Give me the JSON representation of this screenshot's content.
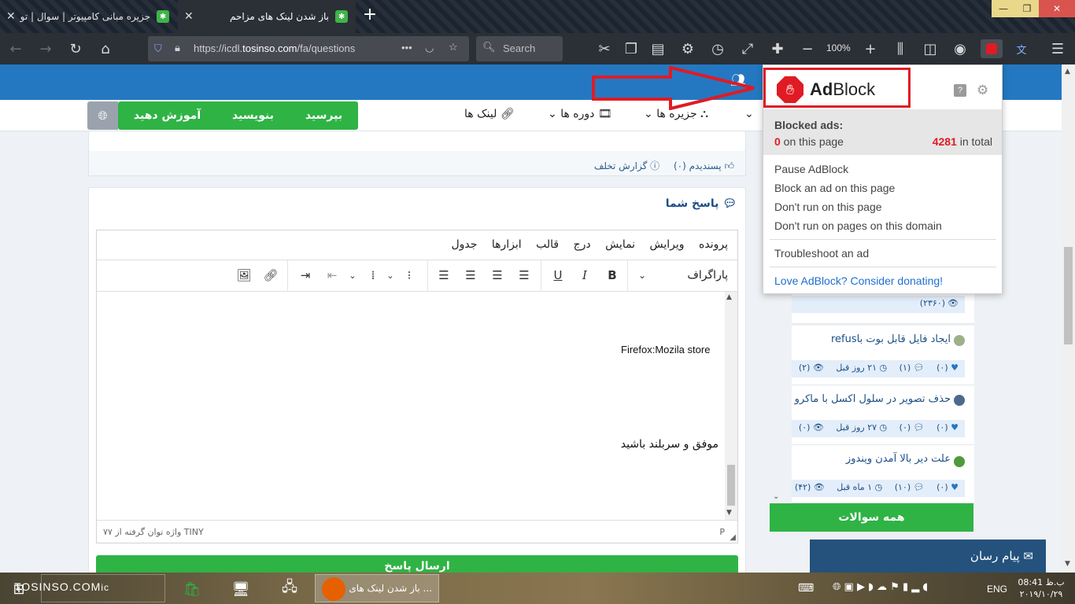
{
  "browser": {
    "tabs": [
      {
        "title": "جزیره مبانی کامپیوتر | سوال | تو",
        "active": false
      },
      {
        "title": "باز شدن لینک های مزاحم",
        "active": true
      }
    ],
    "url_prefix": "https://icdl.",
    "url_host": "tosinso.com",
    "url_path": "/fa/questions",
    "search_placeholder": "Search",
    "zoom": "100%",
    "more_dots": "•••"
  },
  "site": {
    "buttons": {
      "ask": "بپرسید",
      "write": "بنویسید",
      "teach": "آموزش دهید"
    },
    "nav": {
      "links": "لینک ها",
      "courses": "دوره ها",
      "islands": "جزیره ها"
    },
    "actions": {
      "like": "پسندیدم (۰)",
      "report": "گزارش تخلف"
    },
    "answer_title": "پاسخ شما"
  },
  "editor": {
    "menu": [
      "پرونده",
      "ویرایش",
      "نمایش",
      "درج",
      "قالب",
      "ابزارها",
      "جدول"
    ],
    "block_format": "پاراگراف",
    "lines": [
      "Firefox:Mozila store",
      "موفق و سربلند باشید"
    ],
    "status_path": "P",
    "word_count": "۷۷ واژه توان گرفته از TINY",
    "submit": "ارسال پاسخ"
  },
  "sidebar": {
    "first_views": "(۲۳۶۰)",
    "questions": [
      {
        "title": "ایجاد فایل قابل بوت باrefus",
        "likes": "(۰)",
        "comments": "(۱)",
        "time": "۲۱ روز قبل",
        "views": "(۲)"
      },
      {
        "title": "حذف تصویر در سلول اکسل با ماکرو",
        "likes": "(۰)",
        "comments": "(۰)",
        "time": "۲۷ روز قبل",
        "views": "(۰)"
      },
      {
        "title": "علت دیر بالا آمدن ویندوز",
        "likes": "(۰)",
        "comments": "(۱۰)",
        "time": "۱ ماه قبل",
        "views": "(۴۲)"
      }
    ],
    "all_questions": "همه سوالات",
    "messenger": "پیام رسان"
  },
  "adblock": {
    "brand_bold": "Ad",
    "brand_rest": "Block",
    "blocked_label": "Blocked ads:",
    "page_count": "0",
    "page_suffix": " on this page",
    "total_count": "4281",
    "total_suffix": " in total",
    "menu": [
      "Pause AdBlock",
      "Block an ad on this page",
      "Don't run on this page",
      "Don't run on pages on this domain"
    ],
    "troubleshoot": "Troubleshoot an ad",
    "donate": "Love AdBlock? Consider donating!"
  },
  "taskbar": {
    "watermark": "TOSINSO.COM",
    "watermark_tail": "ic",
    "app_label": "... باز شدن لینک های",
    "lang": "ENG",
    "time": "08:41 ب.ظ",
    "date": "۲۰۱۹/۱۰/۲۹"
  },
  "colors": {
    "site_blue": "#2478c2",
    "green": "#2fb345",
    "adblock_red": "#e01b24",
    "link_blue": "#1c4f86"
  }
}
